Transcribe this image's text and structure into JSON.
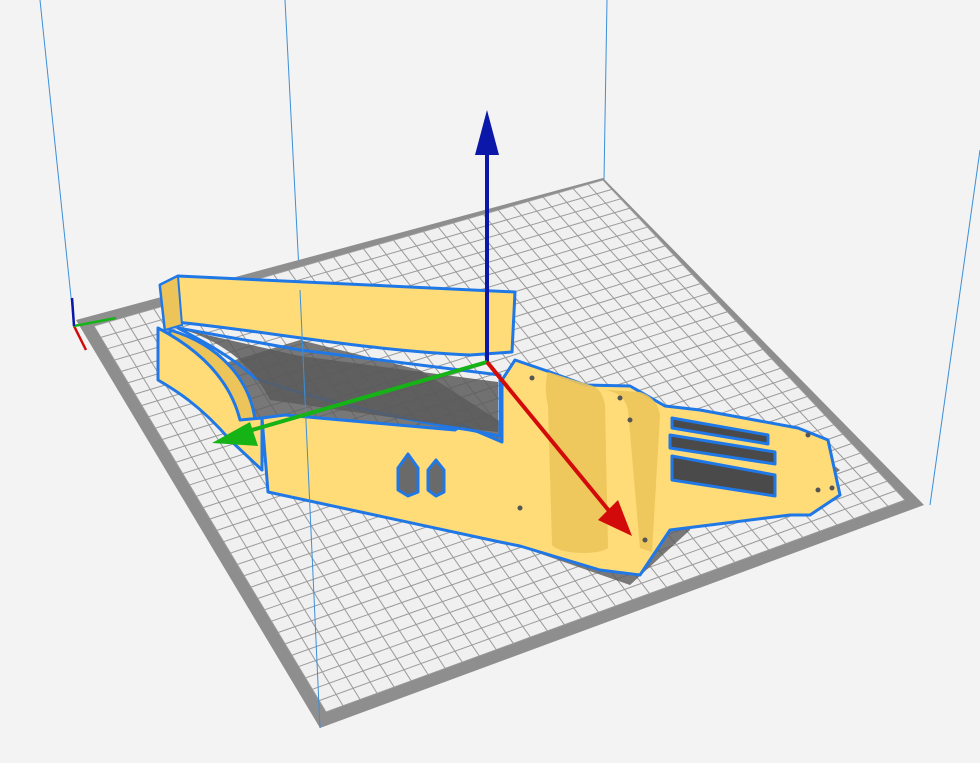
{
  "viewport": {
    "background": "#f3f3f3",
    "build_volume_color": "#3c8fd8",
    "plate_fill": "#f0f0f0",
    "plate_border": "#8d8d8d",
    "grid_color": "#9a9a9a"
  },
  "model": {
    "fill": "#ffdc78",
    "side_fill": "#ecc45a",
    "selection_outline": "#1f78e6",
    "shadow": "#5a5a5a"
  },
  "gizmo": {
    "x_axis": {
      "icon": "arrow-red-icon",
      "color": "#d30a0a"
    },
    "y_axis": {
      "icon": "arrow-green-icon",
      "color": "#15b315"
    },
    "z_axis": {
      "icon": "arrow-blue-icon",
      "color": "#0a17a8"
    }
  },
  "origin_indicator": {
    "x_color": "#d30a0a",
    "y_color": "#15b315",
    "z_color": "#0a17a8"
  }
}
